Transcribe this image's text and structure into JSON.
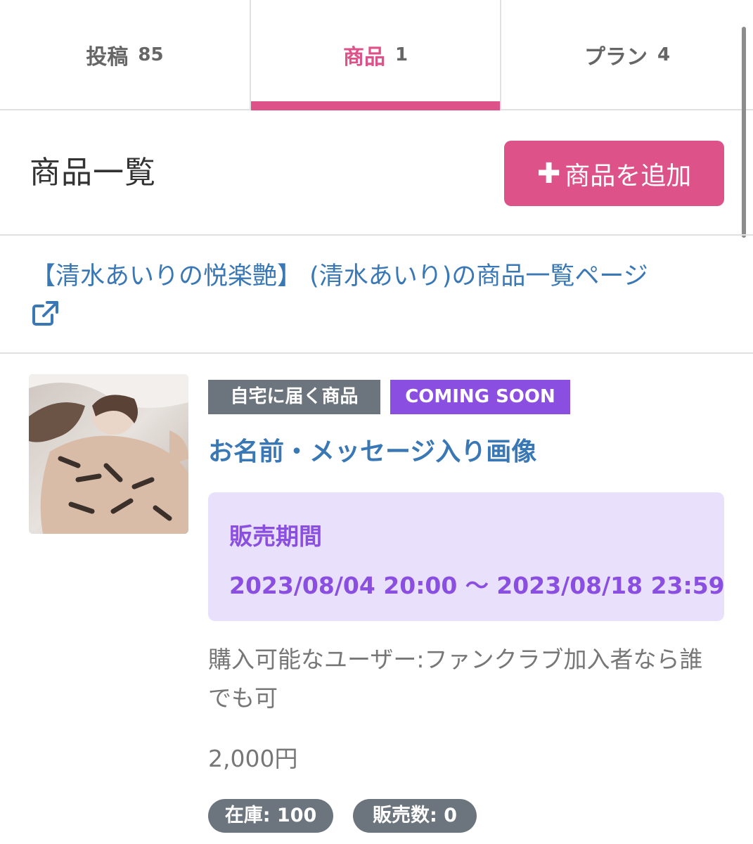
{
  "tabs": [
    {
      "label": "投稿",
      "count": "85"
    },
    {
      "label": "商品",
      "count": "1"
    },
    {
      "label": "プラン",
      "count": "4"
    }
  ],
  "header": {
    "title": "商品一覧",
    "add_button_icon": "plus-icon",
    "add_button_label": "商品を追加"
  },
  "shop_link": {
    "text": "【清水あいりの悦楽艶】 (清水あいり)の商品一覧ページ",
    "icon": "external-link-icon"
  },
  "product": {
    "badges": {
      "home": "自宅に届く商品",
      "status": "COMING SOON"
    },
    "name": "お名前・メッセージ入り画像",
    "period_label": "販売期間",
    "period_range": "2023/08/04 20:00 〜 2023/08/18 23:59",
    "buyers": "購入可能なユーザー:ファンクラブ加入者なら誰でも可",
    "price": "2,000円",
    "stock": "在庫: 100",
    "sold": "販売数: 0"
  },
  "colors": {
    "accent": "#dd5289",
    "link": "#3a78b5",
    "purple": "#8a4fe0",
    "period_bg": "#e9e0fb",
    "badge_gray": "#6c757d"
  }
}
